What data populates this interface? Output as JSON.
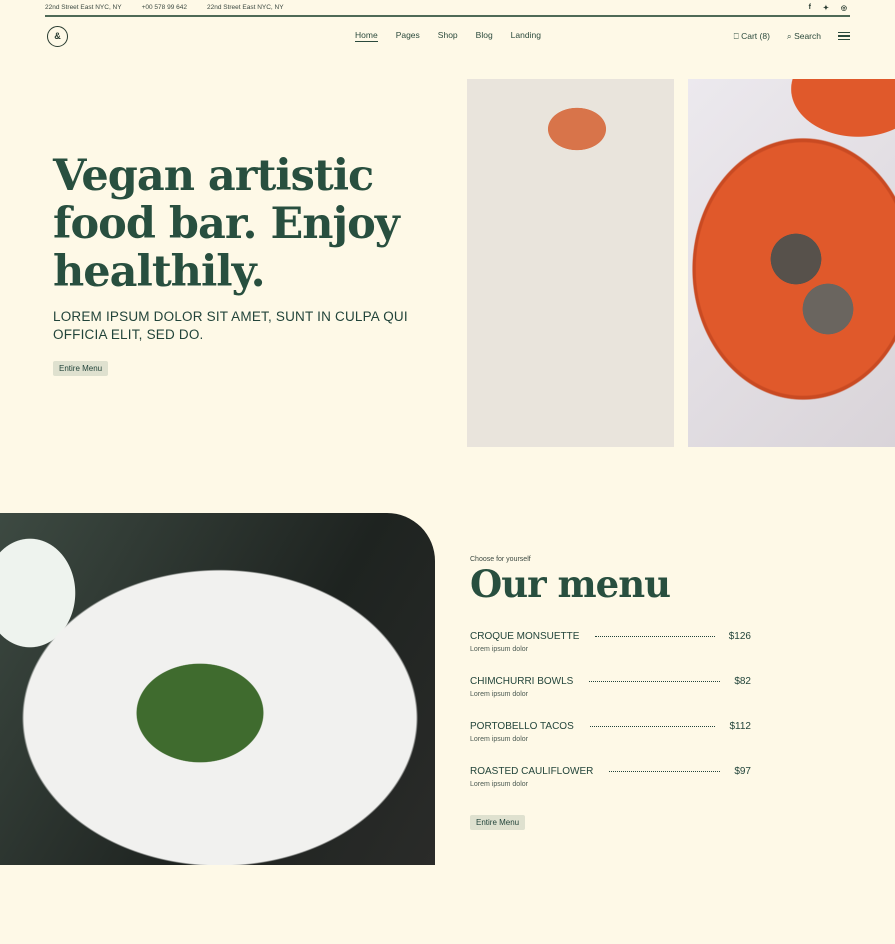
{
  "topbar": {
    "info": [
      "22nd Street East NYC, NY",
      "+00 578 99 642",
      "22nd Street East NYC, NY"
    ],
    "social": [
      {
        "icon": "facebook-icon",
        "glyph": "f"
      },
      {
        "icon": "twitter-icon",
        "glyph": "✦"
      },
      {
        "icon": "instagram-icon",
        "glyph": "◎"
      }
    ]
  },
  "nav": {
    "logo": "&",
    "menu": [
      "Home",
      "Pages",
      "Shop",
      "Blog",
      "Landing"
    ],
    "active": "Home",
    "cart": "Cart (8)",
    "cart_icon": "⎕",
    "search": "Search",
    "search_icon": "⌕"
  },
  "hero": {
    "title": "Vegan artistic food bar. Enjoy healthily.",
    "subtitle": "LOREM IPSUM DOLOR SIT AMET, SUNT IN CULPA QUI OFFICIA ELIT, SED DO.",
    "button": "Entire Menu"
  },
  "menu_section": {
    "eyebrow": "Choose for yourself",
    "title": "Our menu",
    "items": [
      {
        "name": "CROQUE MONSUETTE",
        "price": "$126",
        "desc": "Lorem ipsum dolor"
      },
      {
        "name": "CHIMCHURRI BOWLS",
        "price": "$82",
        "desc": "Lorem ipsum dolor"
      },
      {
        "name": "PORTOBELLO TACOS",
        "price": "$112",
        "desc": "Lorem ipsum dolor"
      },
      {
        "name": "ROASTED CAULIFLOWER",
        "price": "$97",
        "desc": "Lorem ipsum dolor"
      }
    ],
    "button": "Entire Menu"
  },
  "colors": {
    "background": "#fef9e7",
    "primary": "#284f3f",
    "button_bg": "#dfe1cf"
  }
}
